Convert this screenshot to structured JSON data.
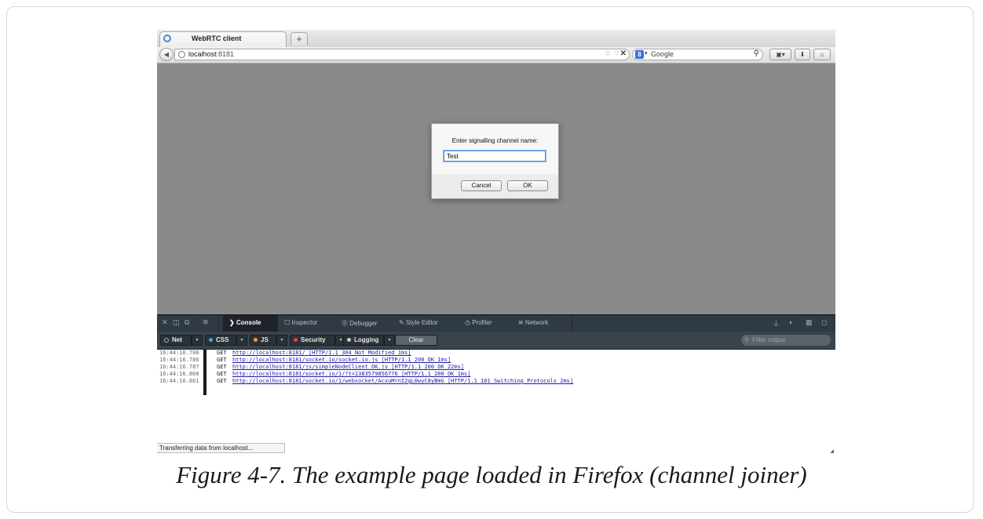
{
  "browser": {
    "tab_title": "WebRTC client",
    "new_tab_label": "+",
    "url_host": "localhost",
    "url_port": ":8181",
    "search_placeholder": "Google"
  },
  "dialog": {
    "prompt": "Enter signalling channel name:",
    "input_value": "Test",
    "cancel_label": "Cancel",
    "ok_label": "OK"
  },
  "devtools": {
    "tabs": [
      "Console",
      "Inspector",
      "Debugger",
      "Style Editor",
      "Profiler",
      "Network"
    ],
    "active_tab": "Console",
    "filters": [
      {
        "label": "Net",
        "color": "#2a3137"
      },
      {
        "label": "CSS",
        "color": "#2bb5e8"
      },
      {
        "label": "JS",
        "color": "#f3a13b"
      },
      {
        "label": "Security",
        "color": "#e5473a"
      },
      {
        "label": "Logging",
        "color": "#c9ccd0"
      }
    ],
    "clear_label": "Clear",
    "filter_placeholder": "Filter output"
  },
  "console_log": [
    {
      "time": "16:44:16.706",
      "method": "GET",
      "url": "http://localhost:8181/",
      "status": "[HTTP/1.1 304 Not Modified 1ms]"
    },
    {
      "time": "16:44:16.786",
      "method": "GET",
      "url": "http://localhost:8181/socket.io/socket.io.js",
      "status": "[HTTP/1.1 200 OK 1ms]"
    },
    {
      "time": "16:44:16.787",
      "method": "GET",
      "url": "http://localhost:8181/js/simpleNodeClient_OK.js",
      "status": "[HTTP/1.1 200 OK 22ms]"
    },
    {
      "time": "16:44:16.860",
      "method": "GET",
      "url": "http://localhost:8181/socket.io/1/?t=1383579856776",
      "status": "[HTTP/1.1 200 OK 1ms]"
    },
    {
      "time": "16:44:16.861",
      "method": "GET",
      "url": "http://localhost:8181/socket.io/1/websocket/AcxuMrnI2gL0wyC8yBmG",
      "status": "[HTTP/1.1 101 Switching Protocols 2ms]"
    }
  ],
  "status_text": "Transferring data from localhost...",
  "caption": "Figure 4-7. The example page loaded in Firefox (channel joiner)"
}
